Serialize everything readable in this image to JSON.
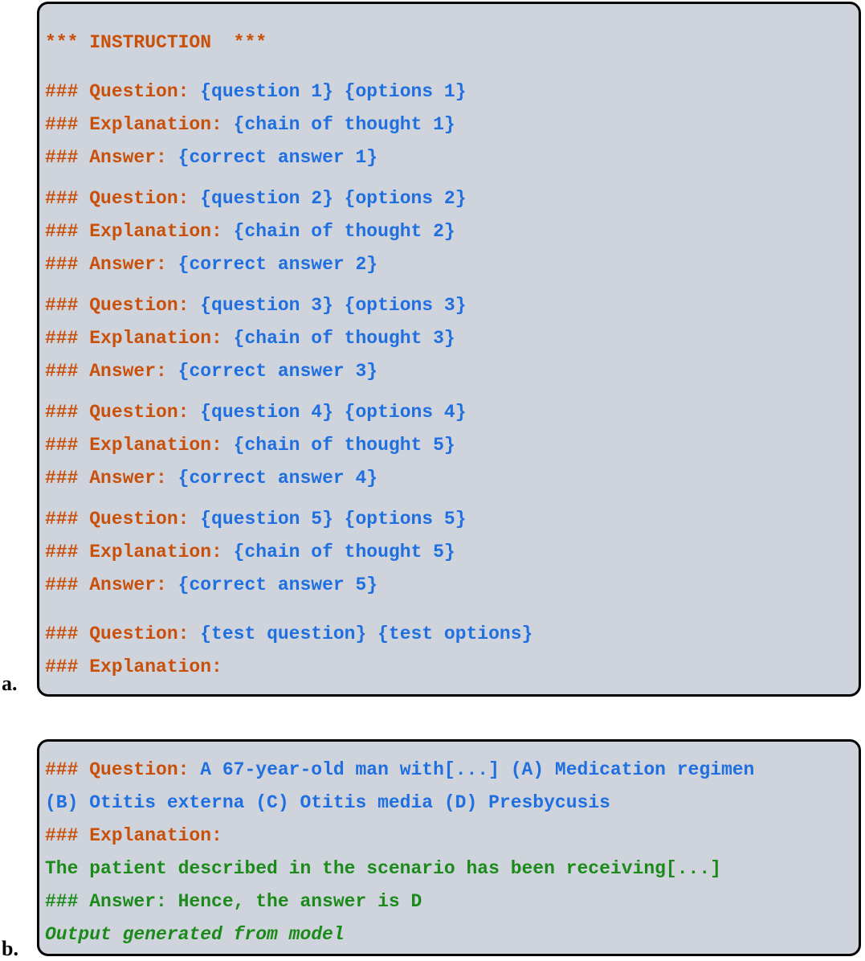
{
  "panel_a": {
    "label": "a.",
    "instruction": "*** INSTRUCTION  ***",
    "examples": [
      {
        "q_label": "### Question:",
        "q": "{question 1} {options 1}",
        "e_label": "### Explanation:",
        "e": "{chain of thought 1}",
        "a_label": "### Answer:",
        "a": "{correct answer 1}"
      },
      {
        "q_label": "### Question:",
        "q": "{question 2} {options 2}",
        "e_label": "### Explanation:",
        "e": "{chain of thought 2}",
        "a_label": "### Answer:",
        "a": "{correct answer 2}"
      },
      {
        "q_label": "### Question:",
        "q": "{question 3} {options 3}",
        "e_label": "### Explanation:",
        "e": "{chain of thought 3}",
        "a_label": "### Answer:",
        "a": "{correct answer 3}"
      },
      {
        "q_label": "### Question:",
        "q": "{question 4} {options 4}",
        "e_label": "### Explanation:",
        "e": "{chain of thought 5}",
        "a_label": "### Answer:",
        "a": "{correct answer 4}"
      },
      {
        "q_label": "### Question:",
        "q": "{question 5} {options 5}",
        "e_label": "### Explanation:",
        "e": "{chain of thought 5}",
        "a_label": "### Answer:",
        "a": "{correct answer 5}"
      }
    ],
    "test": {
      "q_label": "### Question:",
      "q": "{test question} {test options}",
      "e_label": "### Explanation:"
    }
  },
  "panel_b": {
    "label": "b.",
    "q_label": "### Question:",
    "q_line1": "A 67-year-old man with[...] (A) Medication regimen",
    "q_line2": "(B) Otitis externa (C) Otitis media (D) Presbycusis",
    "e_label": "### Explanation:",
    "output_line1": "The patient described in the scenario has been receiving[...]",
    "output_line2": "### Answer: Hence, the answer is D",
    "note": "Output generated from model"
  },
  "colors": {
    "label": "#c8500a",
    "placeholder": "#1f6fe0",
    "output": "#1a8a1a",
    "box_bg": "#cfd3db"
  }
}
